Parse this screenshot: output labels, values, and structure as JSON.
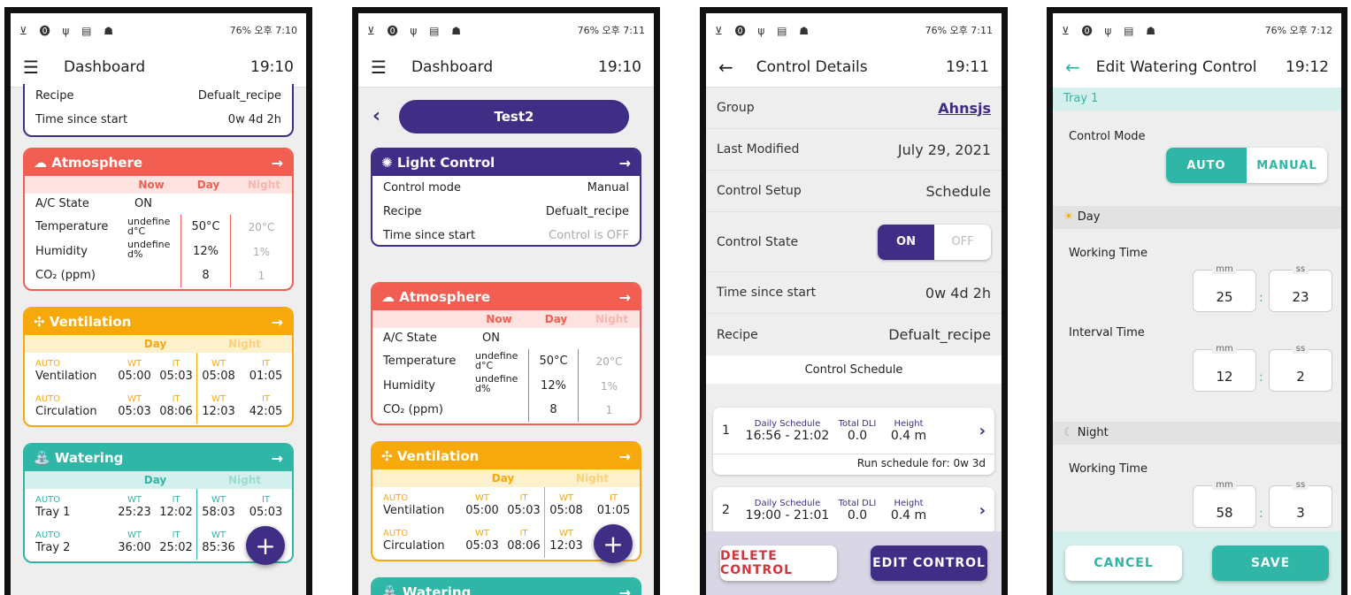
{
  "status": {
    "icons": "⊻ ⓿ ψ ▤ ☗",
    "right1": "76% 오후 7:10",
    "right2": "76% 오후 7:11",
    "right3": "76% 오후 7:11",
    "right4": "76% 오후 7:12"
  },
  "s1": {
    "title": "Dashboard",
    "time": "19:10",
    "top": {
      "recipe_label": "Recipe",
      "recipe_val": "Defualt_recipe",
      "tss_label": "Time since start",
      "tss_val": "0w 4d 2h"
    },
    "atm": {
      "title": "Atmosphere",
      "now": "Now",
      "day": "Day",
      "night": "Night",
      "ac_label": "A/C State",
      "ac_val": "ON",
      "temp_label": "Temperature",
      "hum_label": "Humidity",
      "co2_label": "CO₂ (ppm)",
      "temp_now": "undefine d°C",
      "hum_now": "undefine d%",
      "temp_day": "50°C",
      "temp_night": "20°C",
      "hum_day": "12%",
      "hum_night": "1%",
      "co2_day": "8",
      "co2_night": "1"
    },
    "vent": {
      "title": "Ventilation",
      "day": "Day",
      "night": "Night",
      "auto": "AUTO",
      "wt": "WT",
      "it": "IT",
      "r1_name": "Ventilation",
      "r1": [
        "05:00",
        "05:03",
        "05:08",
        "01:05"
      ],
      "r2_name": "Circulation",
      "r2": [
        "05:03",
        "08:06",
        "12:03",
        "42:05"
      ]
    },
    "water": {
      "title": "Watering",
      "day": "Day",
      "night": "Night",
      "auto": "AUTO",
      "wt": "WT",
      "it": "IT",
      "r1_name": "Tray 1",
      "r1": [
        "25:23",
        "12:02",
        "58:03",
        "05:03"
      ],
      "r2_name": "Tray 2",
      "r2": [
        "36:00",
        "25:02",
        "85:36"
      ]
    },
    "fab": "+"
  },
  "s2": {
    "title": "Dashboard",
    "time": "19:10",
    "group": "Test2",
    "light": {
      "title": "Light Control",
      "mode_label": "Control mode",
      "mode_val": "Manual",
      "recipe_label": "Recipe",
      "recipe_val": "Defualt_recipe",
      "tss_label": "Time since start",
      "tss_val": "Control is OFF"
    },
    "atm": {
      "title": "Atmosphere",
      "now": "Now",
      "day": "Day",
      "night": "Night",
      "ac_label": "A/C State",
      "ac_val": "ON",
      "temp_label": "Temperature",
      "hum_label": "Humidity",
      "co2_label": "CO₂ (ppm)",
      "temp_now": "undefine d°C",
      "hum_now": "undefine d%",
      "temp_day": "50°C",
      "temp_night": "20°C",
      "hum_day": "12%",
      "hum_night": "1%",
      "co2_day": "8",
      "co2_night": "1"
    },
    "vent": {
      "title": "Ventilation",
      "day": "Day",
      "night": "Night",
      "auto": "AUTO",
      "wt": "WT",
      "it": "IT",
      "r1_name": "Ventilation",
      "r1": [
        "05:00",
        "05:03",
        "05:08",
        "01:05"
      ],
      "r2_name": "Circulation",
      "r2": [
        "05:03",
        "08:06",
        "12:03"
      ]
    },
    "water_title": "Watering",
    "fab": "+"
  },
  "s3": {
    "title": "Control Details",
    "time": "19:11",
    "group_label": "Group",
    "group_val": "Ahnsjs",
    "lm_label": "Last Modified",
    "lm_val": "July 29, 2021",
    "setup_label": "Control Setup",
    "setup_val": "Schedule",
    "state_label": "Control State",
    "on": "ON",
    "off": "OFF",
    "tss_label": "Time since start",
    "tss_val": "0w 4d 2h",
    "recipe_label": "Recipe",
    "recipe_val": "Defualt_recipe",
    "sched_header": "Control Schedule",
    "sched": [
      {
        "num": "1",
        "label": "Daily Schedule",
        "time": "16:56 - 21:02",
        "dli_label": "Total DLI",
        "dli": "0.0",
        "h_label": "Height",
        "h": "0.4 m",
        "run": "Run schedule for: 0w 3d"
      },
      {
        "num": "2",
        "label": "Daily Schedule",
        "time": "19:00 - 21:01",
        "dli_label": "Total DLI",
        "dli": "0.0",
        "h_label": "Height",
        "h": "0.4 m"
      }
    ],
    "delete": "DELETE CONTROL",
    "edit": "EDIT CONTROL"
  },
  "s4": {
    "title": "Edit Watering Control",
    "time": "19:12",
    "tray": "Tray 1",
    "mode_label": "Control Mode",
    "auto": "AUTO",
    "manual": "MANUAL",
    "day": "Day",
    "night": "Night",
    "wt_label": "Working Time",
    "it_label": "Interval Time",
    "mm": "mm",
    "ss": "ss",
    "colon": ":",
    "day_wt_mm": "25",
    "day_wt_ss": "23",
    "day_it_mm": "12",
    "day_it_ss": "2",
    "night_wt_mm": "58",
    "night_wt_ss": "3",
    "cancel": "CANCEL",
    "save": "SAVE"
  },
  "colors": {
    "purple": "#3f2d86",
    "red": "#f25f52",
    "orange": "#f7a90b",
    "teal": "#30b6a6"
  }
}
